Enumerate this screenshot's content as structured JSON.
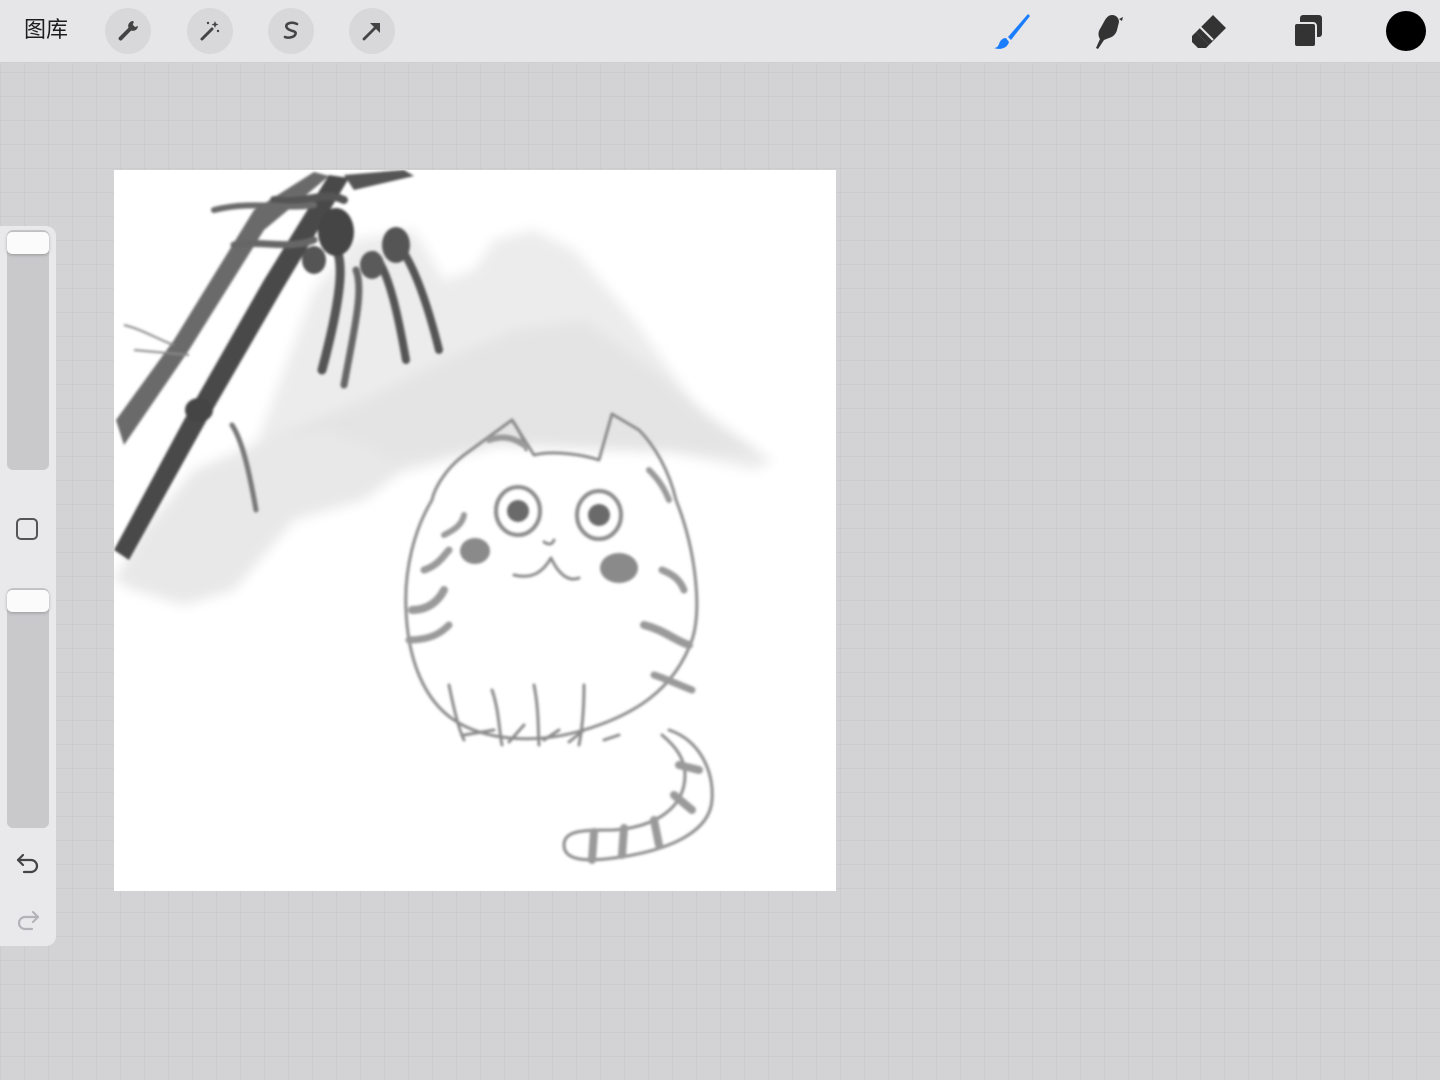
{
  "topbar": {
    "gallery_label": "图库",
    "left_tools": [
      {
        "name": "actions-wrench-icon"
      },
      {
        "name": "adjustments-magic-wand-icon"
      },
      {
        "name": "selection-lasso-icon"
      },
      {
        "name": "transform-arrow-icon"
      }
    ],
    "right_tools": [
      {
        "name": "brush-icon",
        "active": true,
        "color": "#1a7cff"
      },
      {
        "name": "smudge-icon"
      },
      {
        "name": "eraser-icon"
      },
      {
        "name": "layers-icon"
      }
    ],
    "current_color": "#000000"
  },
  "sidebar": {
    "brush_size_level": 1.0,
    "opacity_level": 1.0,
    "icons": [
      "modify-square-icon",
      "undo-icon",
      "redo-icon"
    ]
  },
  "canvas": {
    "background": "#ffffff",
    "artwork": "ink-wash-cat-bamboo-mountains"
  },
  "colors": {
    "ui_background": "#d3d3d6",
    "toolbar": "#e6e6e8",
    "accent": "#1a7cff"
  }
}
